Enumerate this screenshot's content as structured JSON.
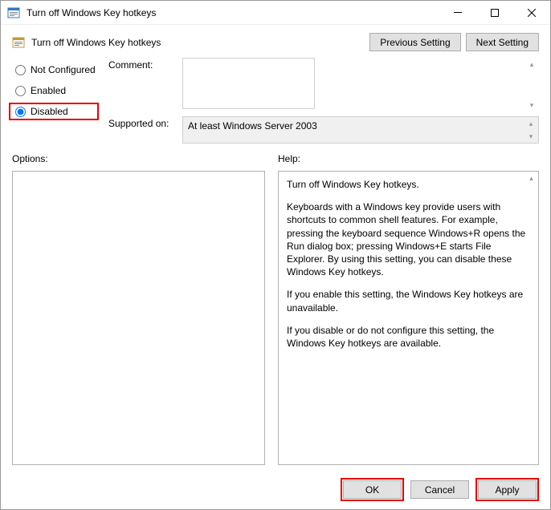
{
  "window": {
    "title": "Turn off Windows Key hotkeys"
  },
  "header": {
    "title": "Turn off Windows Key hotkeys"
  },
  "nav": {
    "previous": "Previous Setting",
    "next": "Next Setting"
  },
  "radios": {
    "not_configured": "Not Configured",
    "enabled": "Enabled",
    "disabled": "Disabled",
    "selected": "disabled"
  },
  "fields": {
    "comment_label": "Comment:",
    "comment_value": "",
    "supported_label": "Supported on:",
    "supported_value": "At least Windows Server 2003"
  },
  "sections": {
    "options_label": "Options:",
    "help_label": "Help:"
  },
  "help": {
    "p1": "Turn off Windows Key hotkeys.",
    "p2": "Keyboards with a Windows key provide users with shortcuts to common shell features. For example, pressing the keyboard sequence Windows+R opens the Run dialog box; pressing Windows+E starts File Explorer. By using this setting, you can disable these Windows Key hotkeys.",
    "p3": "If you enable this setting, the Windows Key hotkeys are unavailable.",
    "p4": "If you disable or do not configure this setting, the Windows Key hotkeys are available."
  },
  "footer": {
    "ok": "OK",
    "cancel": "Cancel",
    "apply": "Apply"
  }
}
